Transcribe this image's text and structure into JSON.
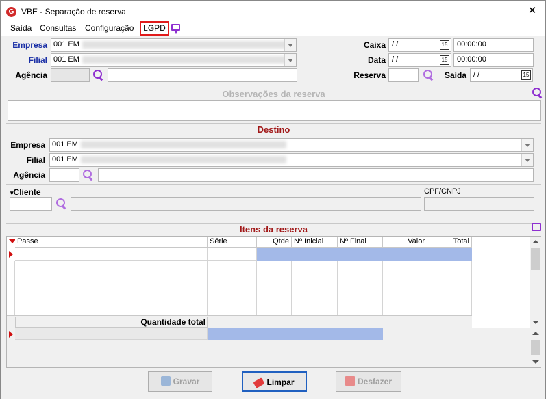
{
  "window": {
    "title": "VBE - Separação de reserva",
    "close_glyph": "✕",
    "logo_letter": "G"
  },
  "menu": {
    "items": [
      "Saída",
      "Consultas",
      "Configuração"
    ],
    "lgpd": "LGPD"
  },
  "origem": {
    "empresa_label": "Empresa",
    "empresa_value": "001 EM",
    "filial_label": "Filial",
    "filial_value": "001 EM",
    "agencia_label": "Agência",
    "caixa_label": "Caixa",
    "caixa_date": "/ /",
    "caixa_time": "00:00:00",
    "data_label": "Data",
    "data_date": "/ /",
    "data_time": "00:00:00",
    "reserva_label": "Reserva",
    "saida_label": "Saída",
    "saida_date": "/ /",
    "calendar_glyph": "15"
  },
  "observacoes": {
    "title": "Observações da reserva"
  },
  "destino": {
    "title": "Destino",
    "empresa_label": "Empresa",
    "empresa_value": "001 EM",
    "filial_label": "Filial",
    "filial_value": "001 EM",
    "agencia_label": "Agência"
  },
  "cliente": {
    "label": "Cliente",
    "cpf_label": "CPF/CNPJ"
  },
  "itens": {
    "title": "Itens da reserva",
    "columns": [
      "Passe",
      "Série",
      "Qtde",
      "Nº Inicial",
      "Nº Final",
      "Valor",
      "Total"
    ],
    "quantidade_total": "Quantidade total"
  },
  "buttons": {
    "gravar": "Gravar",
    "limpar": "Limpar",
    "desfazer": "Desfazer"
  },
  "colors": {
    "accent": "#8e2fd0",
    "section_red": "#a11818",
    "label_blue": "#1a2fa6",
    "selection": "#a3b9e8"
  }
}
